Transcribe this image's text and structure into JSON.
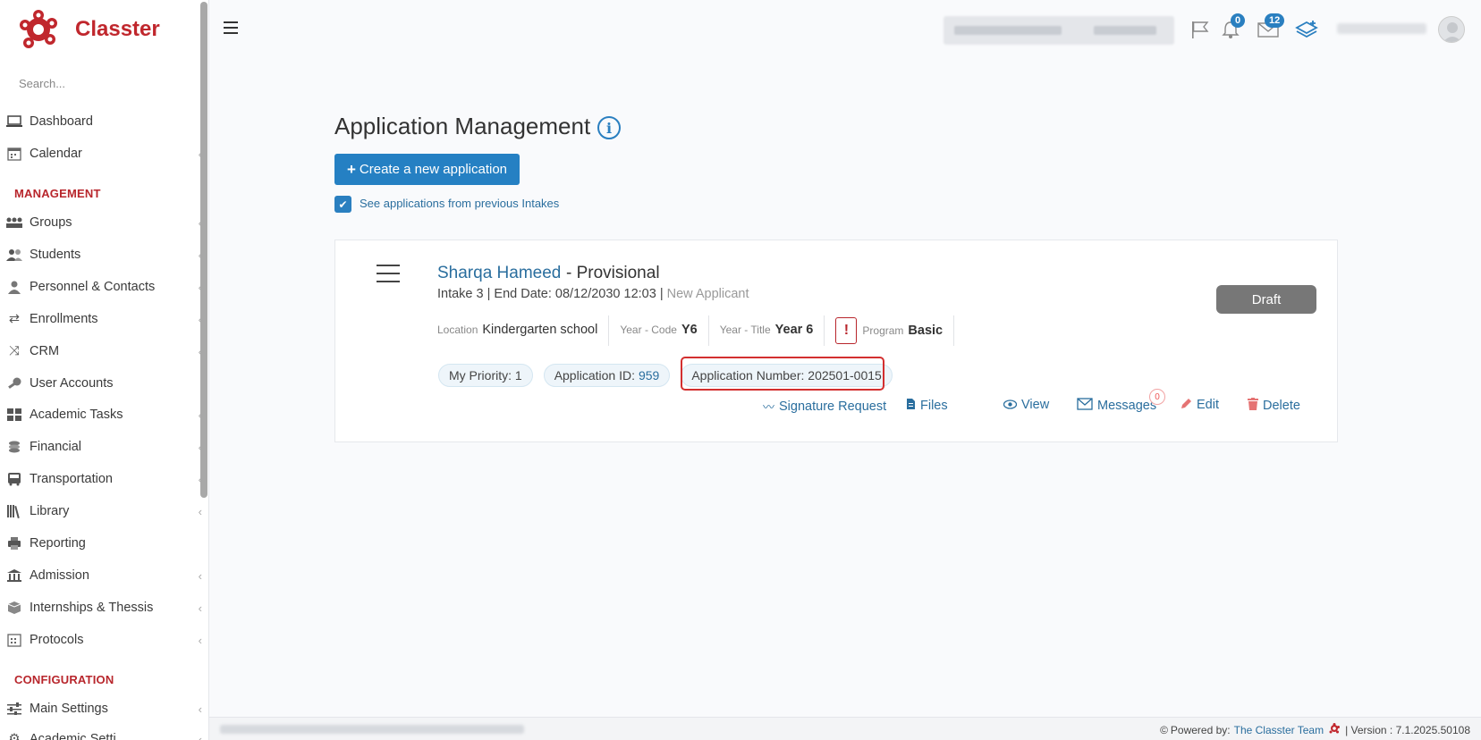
{
  "app": {
    "name": "Classter"
  },
  "sidebar": {
    "search_placeholder": "Search...",
    "items": [
      {
        "label": "Dashboard"
      },
      {
        "label": "Calendar"
      },
      {
        "label": "Groups"
      },
      {
        "label": "Students"
      },
      {
        "label": "Personnel & Contacts"
      },
      {
        "label": "Enrollments"
      },
      {
        "label": "CRM"
      },
      {
        "label": "User Accounts"
      },
      {
        "label": "Academic Tasks"
      },
      {
        "label": "Financial"
      },
      {
        "label": "Transportation"
      },
      {
        "label": "Library"
      },
      {
        "label": "Reporting"
      },
      {
        "label": "Admission"
      },
      {
        "label": "Internships & Thessis"
      },
      {
        "label": "Protocols"
      },
      {
        "label": "Main Settings"
      },
      {
        "label": "Academic Setti..."
      }
    ],
    "sections": {
      "management": "MANAGEMENT",
      "configuration": "CONFIGURATION"
    }
  },
  "topbar": {
    "notifications_count": "0",
    "messages_count": "12"
  },
  "main": {
    "title": "Application Management",
    "create_button": "Create a new application",
    "previous_intakes_label": "See applications from previous Intakes",
    "previous_intakes_checked": true
  },
  "application": {
    "name": "Sharqa Hameed",
    "status": "- Provisional",
    "intake_line": "Intake 3 | End Date: 08/12/2030 12:03 | ",
    "applicant_type": "New Applicant",
    "fields": {
      "location_label": "Location",
      "location_value": "Kindergarten school",
      "year_code_label": "Year - Code",
      "year_code_value": "Y6",
      "year_title_label": "Year - Title",
      "year_title_value": "Year 6",
      "program_label": "Program",
      "program_value": "Basic"
    },
    "draft_label": "Draft",
    "priority": "My Priority: 1",
    "app_id_label": "Application ID:",
    "app_id_value": "959",
    "app_number": "Application Number: 202501-0015",
    "actions": {
      "signature": "Signature Request",
      "files": "Files",
      "view": "View",
      "messages": "Messages",
      "messages_count": "0",
      "edit": "Edit",
      "delete": "Delete"
    }
  },
  "footer": {
    "powered_by": "Powered by:",
    "team": "The Classter Team",
    "version": "| Version : 7.1.2025.50108"
  },
  "colors": {
    "brand": "#c0272d",
    "accent": "#2580c3",
    "highlight": "#d32f2f"
  }
}
